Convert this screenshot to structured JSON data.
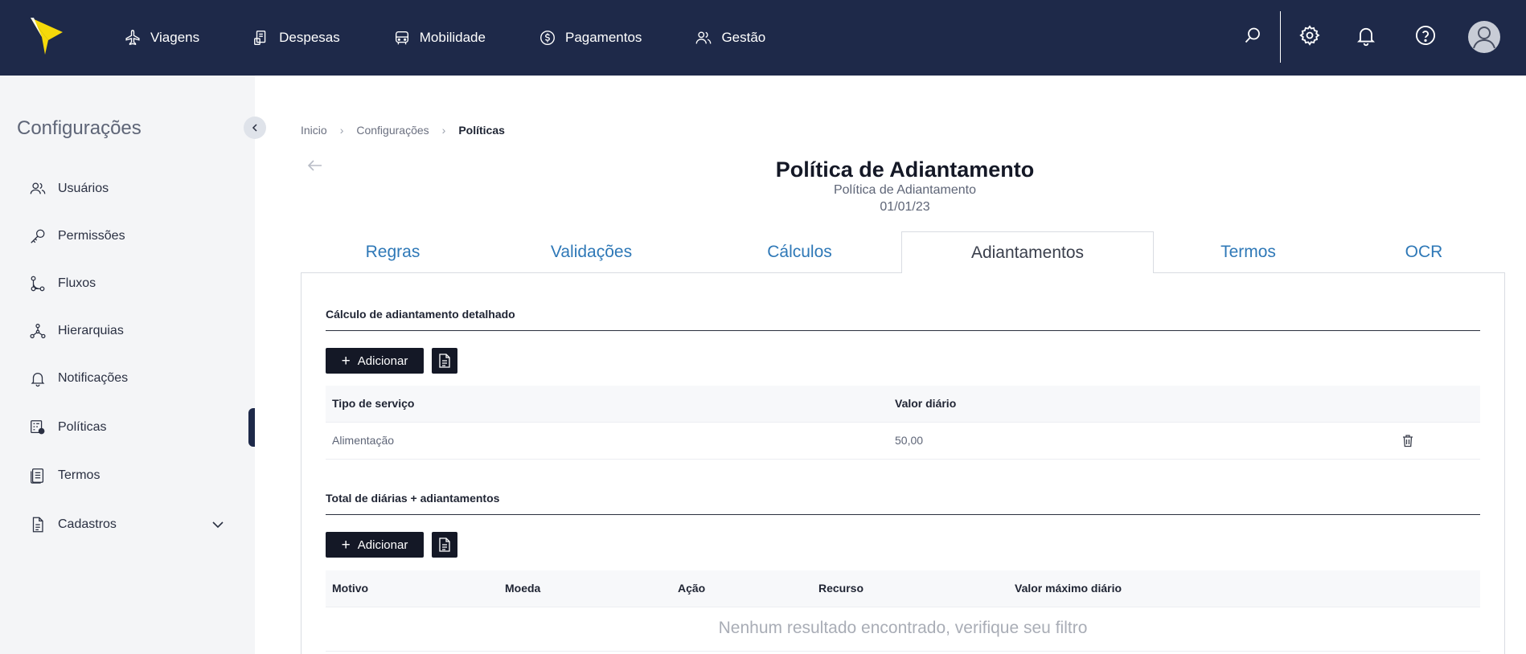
{
  "header": {
    "nav": [
      {
        "label": "Viagens",
        "icon": "plane-icon"
      },
      {
        "label": "Despesas",
        "icon": "receipt-icon"
      },
      {
        "label": "Mobilidade",
        "icon": "car-icon"
      },
      {
        "label": "Pagamentos",
        "icon": "dollar-icon"
      },
      {
        "label": "Gestão",
        "icon": "users-icon"
      }
    ],
    "icons": [
      "search-icon",
      "gear-icon",
      "bell-icon",
      "help-icon",
      "avatar"
    ],
    "background": "#1e2949",
    "accent": "#f5d90a"
  },
  "sidebar": {
    "title": "Configurações",
    "items": [
      {
        "label": "Usuários",
        "icon": "users-icon"
      },
      {
        "label": "Permissões",
        "icon": "key-icon"
      },
      {
        "label": "Fluxos",
        "icon": "flow-icon"
      },
      {
        "label": "Hierarquias",
        "icon": "hierarchy-icon"
      },
      {
        "label": "Notificações",
        "icon": "bell-icon"
      },
      {
        "label": "Políticas",
        "icon": "policy-icon",
        "active": true
      },
      {
        "label": "Termos",
        "icon": "document-icon"
      },
      {
        "label": "Cadastros",
        "icon": "register-icon",
        "expandable": true
      }
    ]
  },
  "breadcrumb": [
    "Inicio",
    "Configurações",
    "Políticas"
  ],
  "page": {
    "title": "Política de Adiantamento",
    "subtitle": "Política de Adiantamento",
    "date": "01/01/23"
  },
  "tabs": [
    {
      "label": "Regras"
    },
    {
      "label": "Validações"
    },
    {
      "label": "Cálculos"
    },
    {
      "label": "Adiantamentos",
      "active": true
    },
    {
      "label": "Termos"
    },
    {
      "label": "OCR"
    }
  ],
  "section1": {
    "title": "Cálculo de adiantamento detalhado",
    "add_label": "Adicionar",
    "columns": [
      "Tipo de serviço",
      "Valor diário"
    ],
    "rows": [
      {
        "tipo": "Alimentação",
        "valor": "50,00"
      }
    ]
  },
  "section2": {
    "title": "Total de diárias + adiantamentos",
    "add_label": "Adicionar",
    "columns": [
      "Motivo",
      "Moeda",
      "Ação",
      "Recurso",
      "Valor máximo diário"
    ],
    "empty_message": "Nenhum resultado encontrado, verifique seu filtro"
  }
}
